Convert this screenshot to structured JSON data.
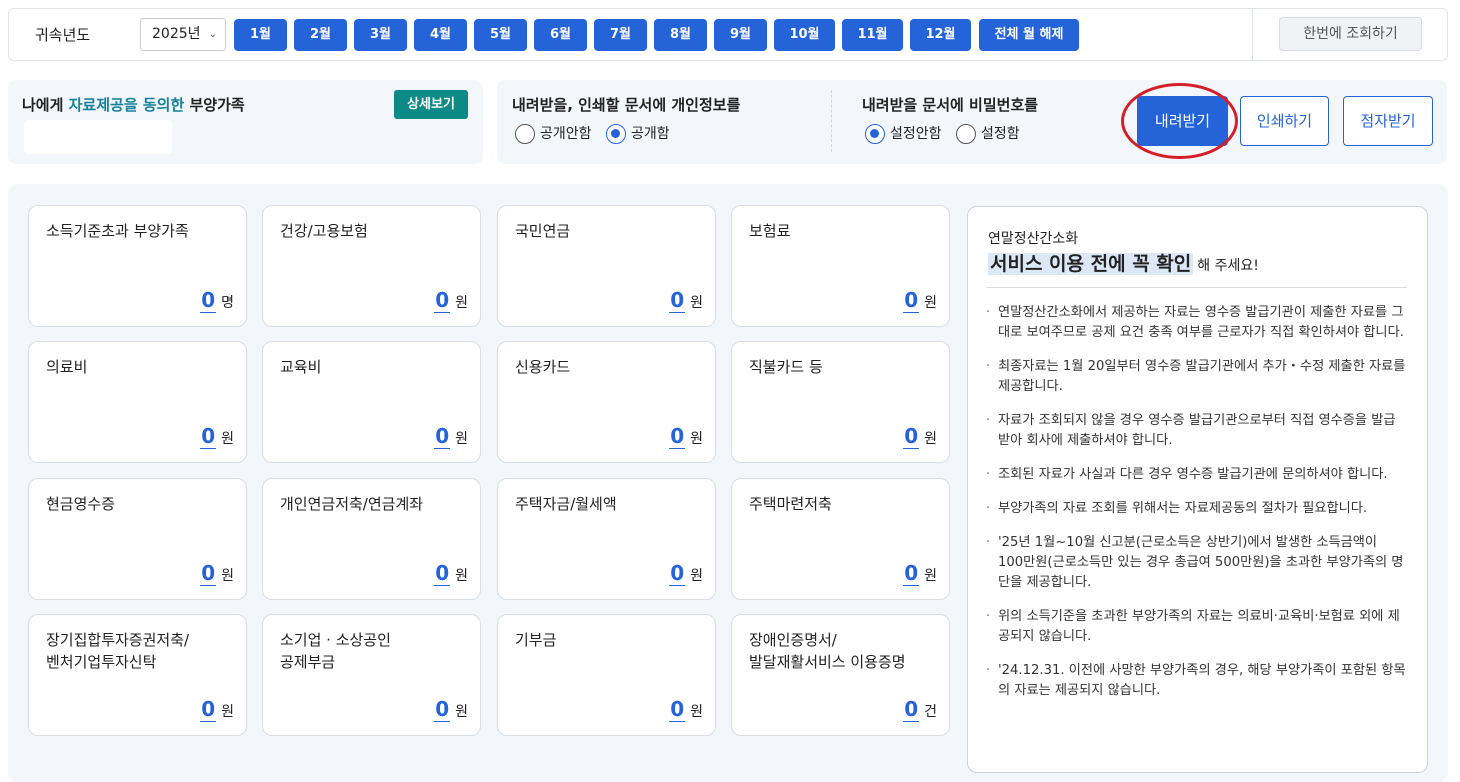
{
  "topbar": {
    "year_label": "귀속년도",
    "year_value": "2025년",
    "months": [
      "1월",
      "2월",
      "3월",
      "4월",
      "5월",
      "6월",
      "7월",
      "8월",
      "9월",
      "10월",
      "11월",
      "12월"
    ],
    "clear_all": "전체 월 해제",
    "query_once": "한번에 조회하기"
  },
  "dependents": {
    "title_prefix": "나에게 ",
    "title_highlight": "자료제공을 동의한",
    "title_suffix": " 부양가족",
    "detail_button": "상세보기"
  },
  "options": {
    "privacy_title": "내려받을, 인쇄할 문서에 개인정보를",
    "privacy_hide": "공개안함",
    "privacy_show": "공개함",
    "privacy_selected": "공개함",
    "password_title": "내려받을 문서에 비밀번호를",
    "password_off": "설정안함",
    "password_on": "설정함",
    "password_selected": "설정안함",
    "download": "내려받기",
    "print": "인쇄하기",
    "braille": "점자받기"
  },
  "cards": [
    {
      "title": "소득기준초과 부양가족",
      "value": "0",
      "unit": "명"
    },
    {
      "title": "건강/고용보험",
      "value": "0",
      "unit": "원"
    },
    {
      "title": "국민연금",
      "value": "0",
      "unit": "원"
    },
    {
      "title": "보험료",
      "value": "0",
      "unit": "원"
    },
    {
      "title": "의료비",
      "value": "0",
      "unit": "원"
    },
    {
      "title": "교육비",
      "value": "0",
      "unit": "원"
    },
    {
      "title": "신용카드",
      "value": "0",
      "unit": "원"
    },
    {
      "title": "직불카드 등",
      "value": "0",
      "unit": "원"
    },
    {
      "title": "현금영수증",
      "value": "0",
      "unit": "원"
    },
    {
      "title": "개인연금저축/연금계좌",
      "value": "0",
      "unit": "원"
    },
    {
      "title": "주택자금/월세액",
      "value": "0",
      "unit": "원"
    },
    {
      "title": "주택마련저축",
      "value": "0",
      "unit": "원"
    },
    {
      "title": "장기집합투자증권저축/\n벤처기업투자신탁",
      "value": "0",
      "unit": "원"
    },
    {
      "title": "소기업 · 소상공인\n공제부금",
      "value": "0",
      "unit": "원"
    },
    {
      "title": "기부금",
      "value": "0",
      "unit": "원"
    },
    {
      "title": "장애인증명서/\n발달재활서비스 이용증명",
      "value": "0",
      "unit": "건"
    }
  ],
  "notice": {
    "subtitle": "연말정산간소화",
    "heading": "서비스 이용 전에 꼭 확인",
    "heading_tail": "해 주세요!",
    "items": [
      "연말정산간소화에서 제공하는 자료는 영수증 발급기관이 제출한 자료를 그대로 보여주므로 공제 요건 충족 여부를 근로자가 직접 확인하셔야 합니다.",
      "최종자료는 1월 20일부터 영수증 발급기관에서 추가・수정 제출한 자료를 제공합니다.",
      "자료가 조회되지 않을 경우 영수증 발급기관으로부터 직접 영수증을 발급받아 회사에 제출하셔야 합니다.",
      "조회된 자료가 사실과 다른 경우 영수증 발급기관에 문의하셔야 합니다.",
      "부양가족의 자료 조회를 위해서는 자료제공동의 절차가 필요합니다.",
      "'25년 1월~10월 신고분(근로소득은 상반기)에서 발생한 소득금액이 100만원(근로소득만 있는 경우 총급여 500만원)을 초과한 부양가족의 명단을 제공합니다.",
      "위의 소득기준을 초과한 부양가족의 자료는 의료비·교육비·보험료 외에 제공되지 않습니다.",
      "'24.12.31. 이전에 사망한 부양가족의 경우, 해당 부양가족이 포함된 항목의 자료는 제공되지 않습니다."
    ]
  }
}
